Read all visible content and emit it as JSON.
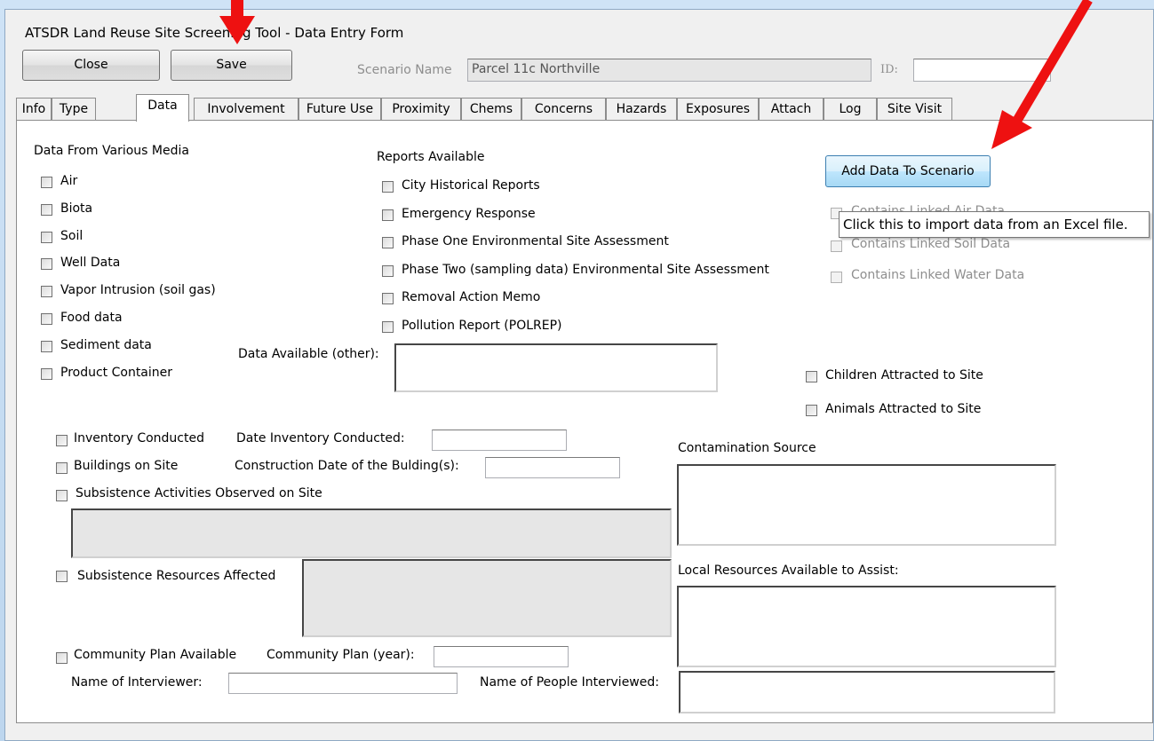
{
  "window": {
    "title": "ATSDR Land Reuse Site Screening Tool - Data Entry Form"
  },
  "toolbar": {
    "close_label": "Close",
    "save_label": "Save",
    "scenario_name_label": "Scenario Name",
    "scenario_name_value": "Parcel 11c Northville",
    "id_label": "ID:",
    "id_value": ""
  },
  "tabs": [
    {
      "label": "Info",
      "active": false
    },
    {
      "label": "Type",
      "active": false
    },
    {
      "label": "Data",
      "active": true
    },
    {
      "label": "Involvement",
      "active": false
    },
    {
      "label": "Future Use",
      "active": false
    },
    {
      "label": "Proximity",
      "active": false
    },
    {
      "label": "Chems",
      "active": false
    },
    {
      "label": "Concerns",
      "active": false
    },
    {
      "label": "Hazards",
      "active": false
    },
    {
      "label": "Exposures",
      "active": false
    },
    {
      "label": "Attach",
      "active": false
    },
    {
      "label": "Log",
      "active": false
    },
    {
      "label": "Site Visit",
      "active": false
    }
  ],
  "media": {
    "heading": "Data From Various Media",
    "items": [
      "Air",
      "Biota",
      "Soil",
      "Well Data",
      "Vapor Intrusion (soil gas)",
      "Food data",
      "Sediment data",
      "Product Container"
    ]
  },
  "reports": {
    "heading": "Reports Available",
    "items": [
      "City Historical Reports",
      "Emergency Response",
      "Phase One Environmental Site Assessment",
      "Phase Two (sampling data) Environmental Site Assessment",
      "Removal Action Memo",
      "Pollution Report (POLREP)"
    ]
  },
  "data_other": {
    "label": "Data Available (other):",
    "value": ""
  },
  "linked": {
    "add_button": "Add Data To Scenario",
    "tooltip": "Click this to import data from an Excel file.",
    "items": [
      "Contains Linked Air Data",
      "Contains Linked Soil Data",
      "Contains Linked Water Data"
    ]
  },
  "attracted": {
    "children": "Children Attracted to Site",
    "animals": "Animals Attracted to Site"
  },
  "inventory": {
    "checkbox": "Inventory Conducted",
    "date_label": "Date Inventory Conducted:",
    "date_value": ""
  },
  "buildings": {
    "checkbox": "Buildings on Site",
    "date_label": "Construction Date of the Bulding(s):",
    "date_value": ""
  },
  "subsistence_activities": {
    "checkbox": "Subsistence Activities Observed on Site",
    "value": ""
  },
  "subsistence_resources": {
    "checkbox": "Subsistence Resources Affected",
    "value": ""
  },
  "community": {
    "checkbox": "Community Plan Available",
    "year_label": "Community Plan (year):",
    "year_value": ""
  },
  "interviewer": {
    "label": "Name of Interviewer:",
    "value": ""
  },
  "interviewed": {
    "label": "Name of People Interviewed:",
    "value": ""
  },
  "contamination": {
    "label": "Contamination Source",
    "value": ""
  },
  "local_resources": {
    "label": "Local Resources Available to Assist:",
    "value": ""
  },
  "colors": {
    "arrow": "#ee1111",
    "accent_button": "#bee6fd"
  }
}
